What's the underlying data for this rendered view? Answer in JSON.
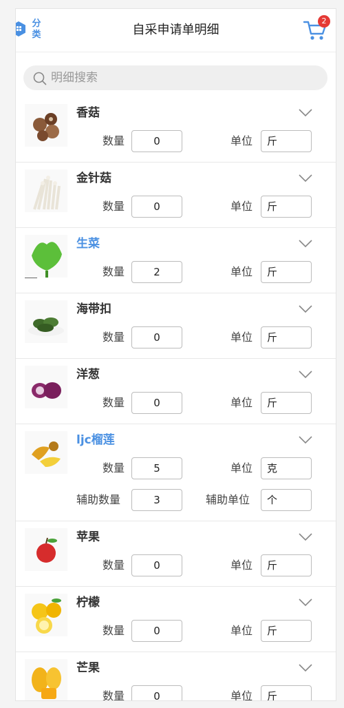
{
  "header": {
    "category_label": "分类",
    "title": "自采申请单明细",
    "cart_count": "2"
  },
  "search": {
    "placeholder": "明细搜索"
  },
  "labels": {
    "qty": "数量",
    "unit": "单位",
    "aux_qty": "辅助数量",
    "aux_unit": "辅助单位"
  },
  "items": [
    {
      "name": "香菇",
      "qty": "0",
      "unit": "斤",
      "highlight": false,
      "icon": "shiitake-icon"
    },
    {
      "name": "金针菇",
      "qty": "0",
      "unit": "斤",
      "highlight": false,
      "icon": "enoki-icon"
    },
    {
      "name": "生菜",
      "qty": "2",
      "unit": "斤",
      "highlight": true,
      "icon": "lettuce-icon"
    },
    {
      "name": "海带扣",
      "qty": "0",
      "unit": "斤",
      "highlight": false,
      "icon": "kelp-icon"
    },
    {
      "name": "洋葱",
      "qty": "0",
      "unit": "斤",
      "highlight": false,
      "icon": "onion-icon"
    },
    {
      "name": "ljc榴莲",
      "qty": "5",
      "unit": "克",
      "aux_qty": "3",
      "aux_unit": "个",
      "highlight": true,
      "icon": "durian-icon"
    },
    {
      "name": "苹果",
      "qty": "0",
      "unit": "斤",
      "highlight": false,
      "icon": "apple-icon"
    },
    {
      "name": "柠檬",
      "qty": "0",
      "unit": "斤",
      "highlight": false,
      "icon": "lemon-icon"
    },
    {
      "name": "芒果",
      "qty": "0",
      "unit": "斤",
      "highlight": false,
      "icon": "mango-icon"
    }
  ],
  "colors": {
    "accent": "#4a90e2",
    "badge": "#e53935"
  }
}
